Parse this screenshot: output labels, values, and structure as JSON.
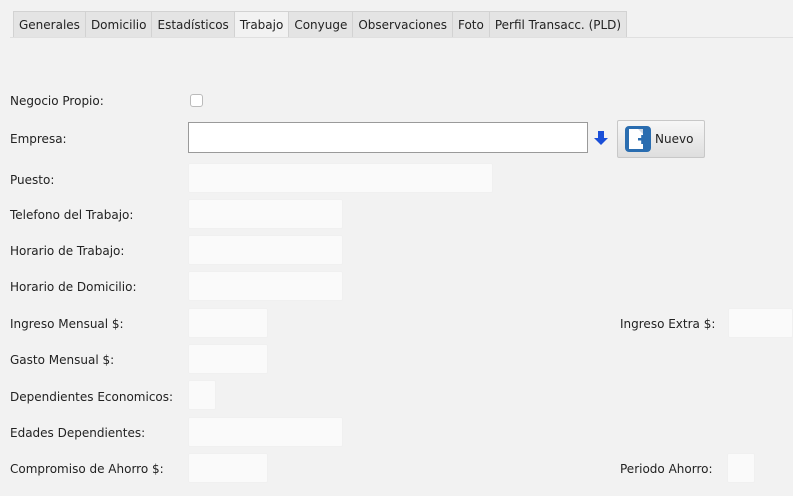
{
  "tabs": [
    "Generales",
    "Domicilio",
    "Estadísticos",
    "Trabajo",
    "Conyuge",
    "Observaciones",
    "Foto",
    "Perfil Transacc. (PLD)"
  ],
  "active_tab": "Trabajo",
  "form": {
    "negocio_propio_label": "Negocio Propio:",
    "negocio_propio_checked": false,
    "empresa_label": "Empresa:",
    "empresa_value": "",
    "nuevo_label": "Nuevo",
    "puesto_label": "Puesto:",
    "telefono_label": "Telefono del Trabajo:",
    "horario_trabajo_label": "Horario de Trabajo:",
    "horario_domicilio_label": "Horario de Domicilio:",
    "ingreso_mensual_label": "Ingreso Mensual $:",
    "ingreso_extra_label": "Ingreso Extra $:",
    "gasto_mensual_label": "Gasto Mensual $:",
    "dependientes_label": "Dependientes Economicos:",
    "edades_label": "Edades Dependientes:",
    "compromiso_label": "Compromiso de Ahorro $:",
    "periodo_label": "Periodo Ahorro:"
  },
  "icons": {
    "dropdown": "blue-down-arrow-icon",
    "new_document": "new-document-icon"
  },
  "colors": {
    "accent_blue": "#1a4fd8"
  }
}
